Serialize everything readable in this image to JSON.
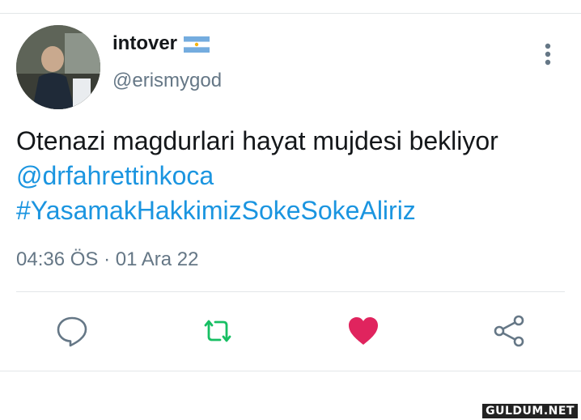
{
  "user": {
    "display_name": "intover",
    "flag_icon": "argentina-flag-icon",
    "handle": "@erismygod"
  },
  "tweet": {
    "text": "Otenazi magdurlari hayat mujdesi bekliyor",
    "mention": "@drfahrettinkoca",
    "hashtag": "#YasamakHakkimizSokeSokeAliriz",
    "timestamp": "04:36 ÖS · 01 Ara 22"
  },
  "actions": [
    {
      "icon": "reply-icon"
    },
    {
      "icon": "retweet-icon",
      "color": "#17bf63"
    },
    {
      "icon": "like-icon",
      "color": "#e0245e"
    },
    {
      "icon": "share-icon"
    }
  ],
  "watermark": "GULDUM.NET",
  "colors": {
    "link": "#1b95e0",
    "secondary_text": "#657786",
    "retweet": "#17bf63",
    "like": "#e0245e"
  }
}
